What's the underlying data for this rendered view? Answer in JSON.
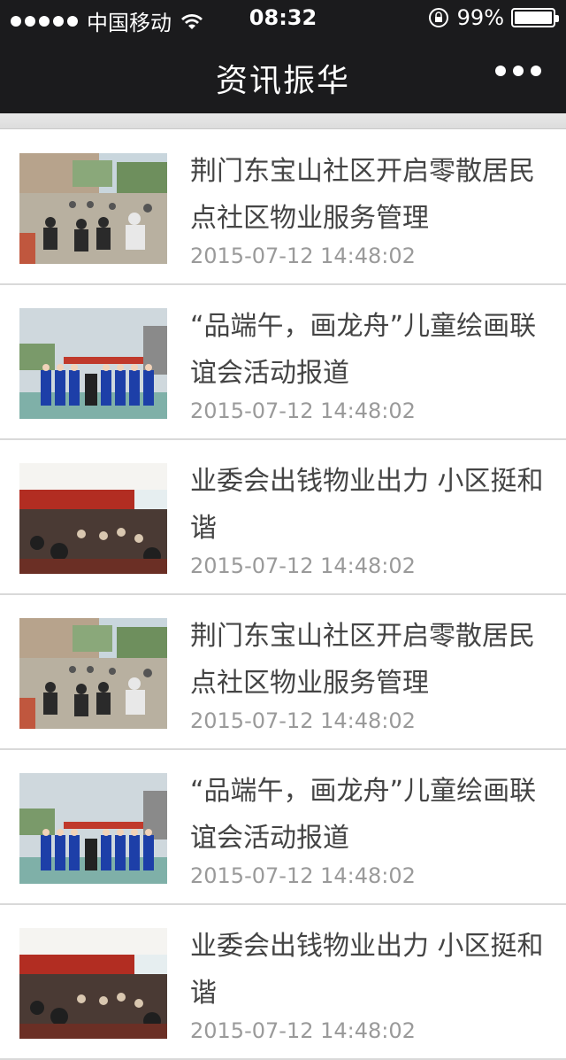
{
  "status": {
    "carrier": "中国移动",
    "time": "08:32",
    "battery": "99%"
  },
  "nav": {
    "title": "资讯振华"
  },
  "news": [
    {
      "title": "荆门东宝山社区开启零散居民点社区物业服务管理",
      "date": "2015-07-12 14:48:02",
      "thumb": "community-meeting"
    },
    {
      "title": "“品端午，画龙舟”儿童绘画联谊会活动报道",
      "date": "2015-07-12 14:48:02",
      "thumb": "choir-performance"
    },
    {
      "title": "业委会出钱物业出力  小区挺和谐",
      "date": "2015-07-12 14:48:02",
      "thumb": "lecture-hall"
    },
    {
      "title": "荆门东宝山社区开启零散居民点社区物业服务管理",
      "date": "2015-07-12 14:48:02",
      "thumb": "community-meeting"
    },
    {
      "title": "“品端午，画龙舟”儿童绘画联谊会活动报道",
      "date": "2015-07-12 14:48:02",
      "thumb": "choir-performance"
    },
    {
      "title": "业委会出钱物业出力  小区挺和谐",
      "date": "2015-07-12 14:48:02",
      "thumb": "lecture-hall"
    }
  ]
}
